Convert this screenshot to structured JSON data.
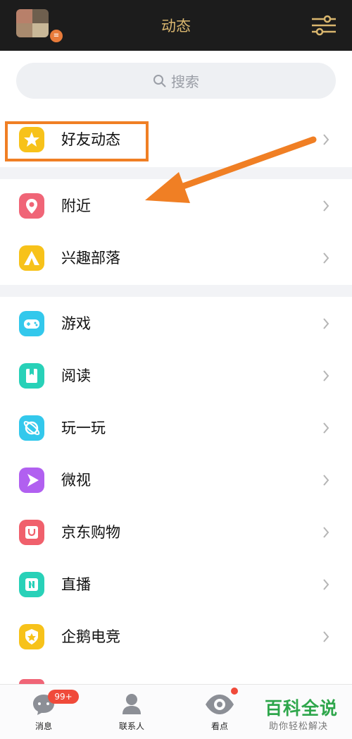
{
  "header": {
    "title": "动态"
  },
  "search": {
    "placeholder": "搜索"
  },
  "sections": [
    {
      "items": [
        {
          "label": "好友动态",
          "icon": "star-face-icon",
          "color": "#f7c21a"
        }
      ]
    },
    {
      "items": [
        {
          "label": "附近",
          "icon": "location-pin-icon",
          "color": "#f06577"
        },
        {
          "label": "兴趣部落",
          "icon": "tent-icon",
          "color": "#f7c21a"
        }
      ]
    },
    {
      "items": [
        {
          "label": "游戏",
          "icon": "gamepad-icon",
          "color": "#33c8ec"
        },
        {
          "label": "阅读",
          "icon": "book-icon",
          "color": "#28d1b8"
        },
        {
          "label": "玩一玩",
          "icon": "planet-icon",
          "color": "#33c8ec"
        },
        {
          "label": "微视",
          "icon": "play-icon",
          "color": "#b160f0"
        },
        {
          "label": "京东购物",
          "icon": "shopping-bag-icon",
          "color": "#f0606c"
        },
        {
          "label": "直播",
          "icon": "live-icon",
          "color": "#28d1b8"
        },
        {
          "label": "企鹅电竞",
          "icon": "esports-shield-icon",
          "color": "#f7c21a"
        }
      ]
    }
  ],
  "tabbar": {
    "tabs": [
      {
        "label": "消息",
        "badge": "99+",
        "icon": "message-icon"
      },
      {
        "label": "联系人",
        "icon": "contacts-icon"
      },
      {
        "label": "看点",
        "icon": "eye-icon"
      }
    ]
  },
  "watermark": {
    "title": "百科全说",
    "subtitle": "助你轻松解决"
  },
  "colors": {
    "header_bg": "#1c1c1c",
    "title_gold": "#d9b66e",
    "highlight_orange": "#f07f24",
    "badge_red": "#f04a3a"
  }
}
